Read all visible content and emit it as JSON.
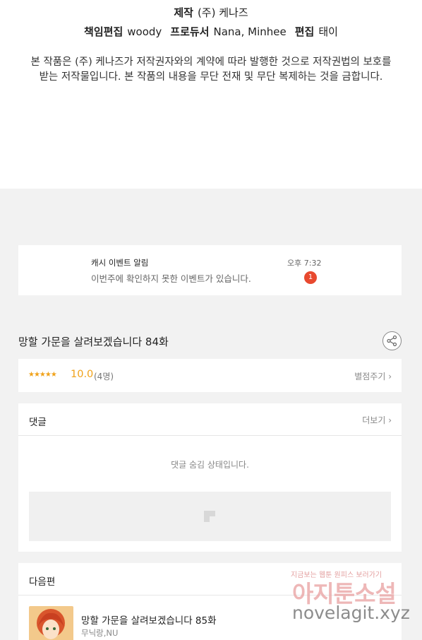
{
  "credits": {
    "production_label": "제작",
    "production_value": "(주) 케나즈",
    "editor_label": "책임편집",
    "editor_value": "woody",
    "producer_label": "프로듀서",
    "producer_value": "Nana, Minhee",
    "editing_label": "편집",
    "editing_value": "태이"
  },
  "copyright_notice": {
    "line1": "본 작품은 (주) 케나즈가 저작권자와의 계약에 따라 발행한 것으로 저작권법의 보호를",
    "line2": "받는 저작물입니다. 본 작품의 내용을 무단 전재 및 무단 복제하는 것을 금합니다."
  },
  "event_notification": {
    "title": "캐시 이벤트 알림",
    "message": "이번주에 확인하지 못한 이벤트가 있습니다.",
    "time": "오후 7:32",
    "badge_count": "1"
  },
  "episode": {
    "title": "망할 가문을 살려보겠습니다 84화",
    "share_icon": "share-icon"
  },
  "rating": {
    "stars": "★★★★★",
    "score": "10.0",
    "count": "(4명)",
    "rate_label": "별점주기 ›"
  },
  "comments": {
    "header": "댓글",
    "more_label": "더보기 ›",
    "hidden_message": "댓글 숨김 상태입니다."
  },
  "next_episode": {
    "header": "다음편",
    "title": "망할 가문을 살려보겠습니다 85화",
    "author": "무닉랑,NU"
  },
  "watermark": {
    "tagline": "지금보는 웹툰 원피스 보러가기",
    "brand": "아지툰소설",
    "url": "novelagit.xyz"
  },
  "colors": {
    "accent_star": "#f0a21a",
    "badge_red": "#e8492f",
    "page_bg": "#f2f2f2"
  }
}
